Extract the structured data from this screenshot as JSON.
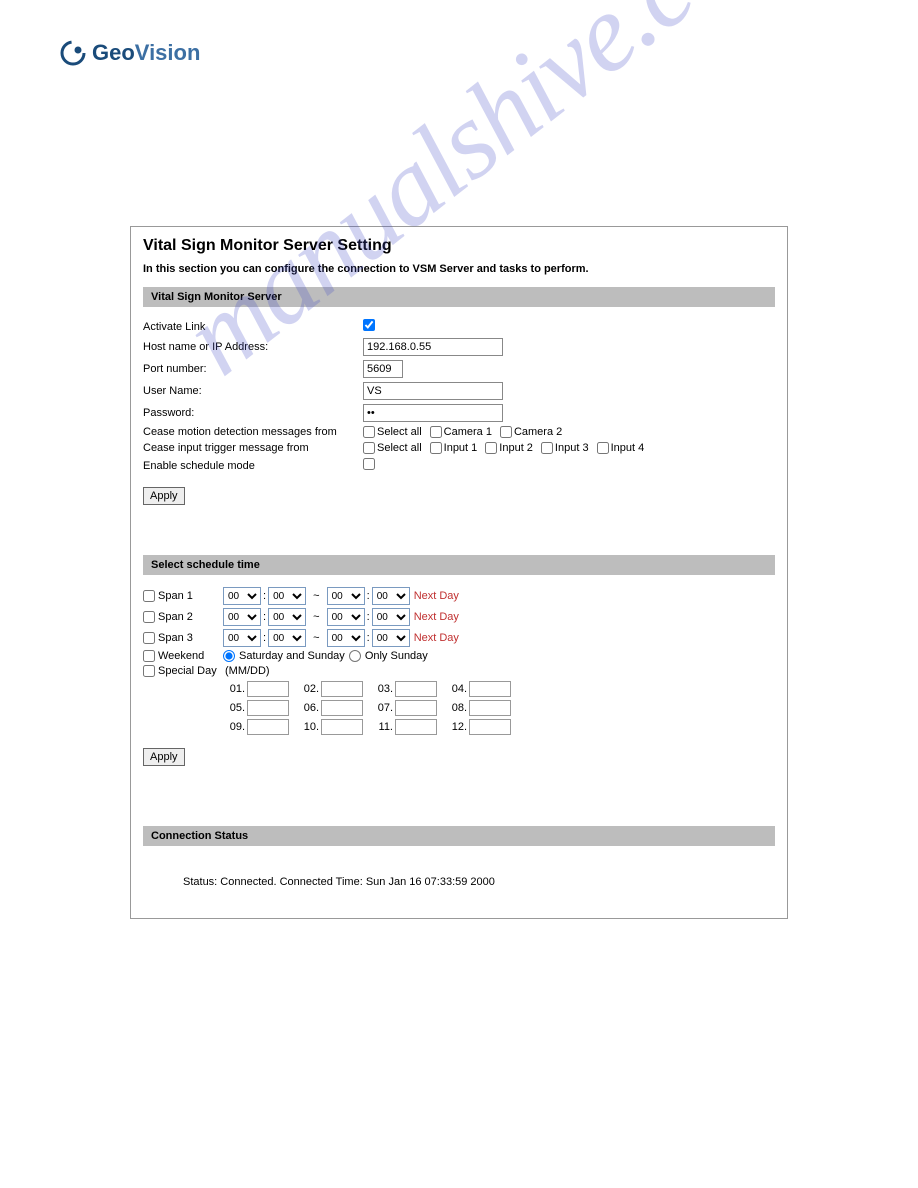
{
  "logo": {
    "geo": "Geo",
    "vision": "Vision"
  },
  "panel": {
    "title": "Vital Sign Monitor Server Setting",
    "desc": "In this section you can configure the connection to VSM Server and tasks to perform.",
    "section1": "Vital Sign Monitor Server",
    "section2": "Select schedule time",
    "section3": "Connection Status"
  },
  "fields": {
    "activate": {
      "label": "Activate Link"
    },
    "host": {
      "label": "Host name or IP Address:",
      "value": "192.168.0.55"
    },
    "port": {
      "label": "Port number:",
      "value": "5609"
    },
    "user": {
      "label": "User Name:",
      "value": "VS"
    },
    "pass": {
      "label": "Password:",
      "value": "••"
    },
    "cease_motion": {
      "label": "Cease motion detection messages from",
      "opts": {
        "all": "Select all",
        "c1": "Camera 1",
        "c2": "Camera 2"
      }
    },
    "cease_input": {
      "label": "Cease input trigger message from",
      "opts": {
        "all": "Select all",
        "i1": "Input 1",
        "i2": "Input 2",
        "i3": "Input 3",
        "i4": "Input 4"
      }
    },
    "enable_sched": {
      "label": "Enable schedule mode"
    }
  },
  "buttons": {
    "apply": "Apply"
  },
  "schedule": {
    "span1": "Span 1",
    "span2": "Span 2",
    "span3": "Span 3",
    "weekend": "Weekend",
    "special": "Special Day",
    "mmdd": "(MM/DD)",
    "time_val": "00",
    "next_day": "Next Day",
    "sat_sun": "Saturday and Sunday",
    "only_sun": "Only Sunday",
    "nums": [
      "01.",
      "02.",
      "03.",
      "04.",
      "05.",
      "06.",
      "07.",
      "08.",
      "09.",
      "10.",
      "11.",
      "12."
    ]
  },
  "status": "Status: Connected. Connected Time: Sun Jan 16 07:33:59 2000",
  "watermark": "manualshive.com"
}
